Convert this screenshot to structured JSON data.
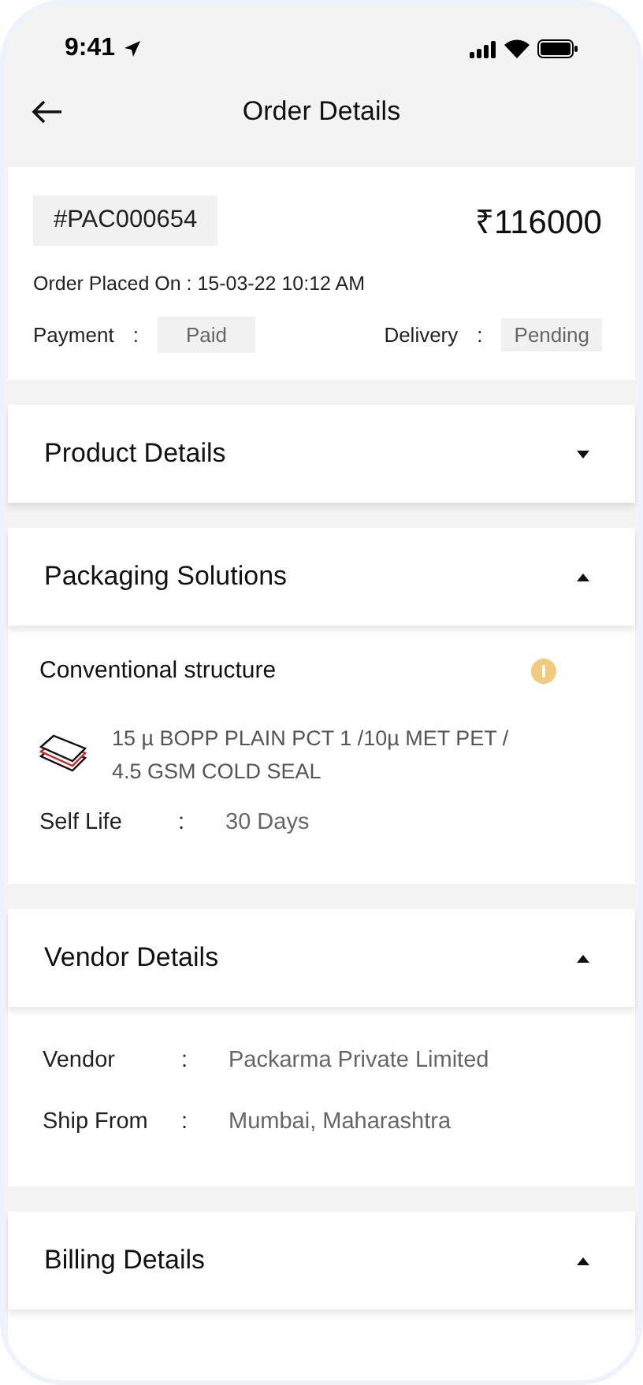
{
  "status_bar": {
    "time": "9:41"
  },
  "header": {
    "title": "Order Details"
  },
  "order": {
    "number": "#PAC000654",
    "amount": "₹116000",
    "placed": "Order Placed On : 15-03-22 10:12 AM",
    "statuses": [
      {
        "label": "Payment",
        "separator": ":",
        "value": "Paid"
      },
      {
        "label": "Delivery",
        "separator": ":",
        "value": "Pending"
      }
    ]
  },
  "sections": [
    {
      "title": "Product Details",
      "expanded": false
    },
    {
      "title": "Packaging Solutions",
      "expanded": true,
      "kind": "structure",
      "structure": {
        "name": "Conventional structure",
        "description": "15 µ BOPP PLAIN PCT 1 /10µ MET PET / 4.5 GSM COLD SEAL",
        "fields": [
          {
            "label": "Self Life",
            "separator": ":",
            "value": "30 Days"
          }
        ]
      }
    },
    {
      "title": "Vendor Details",
      "expanded": true,
      "kind": "fields",
      "fields": [
        {
          "label": "Vendor",
          "separator": ":",
          "value": "Packarma Private Limited"
        },
        {
          "label": "Ship From",
          "separator": ":",
          "value": "Mumbai, Maharashtra"
        }
      ]
    },
    {
      "title": "Billing Details",
      "expanded": true,
      "kind": "fields"
    }
  ]
}
